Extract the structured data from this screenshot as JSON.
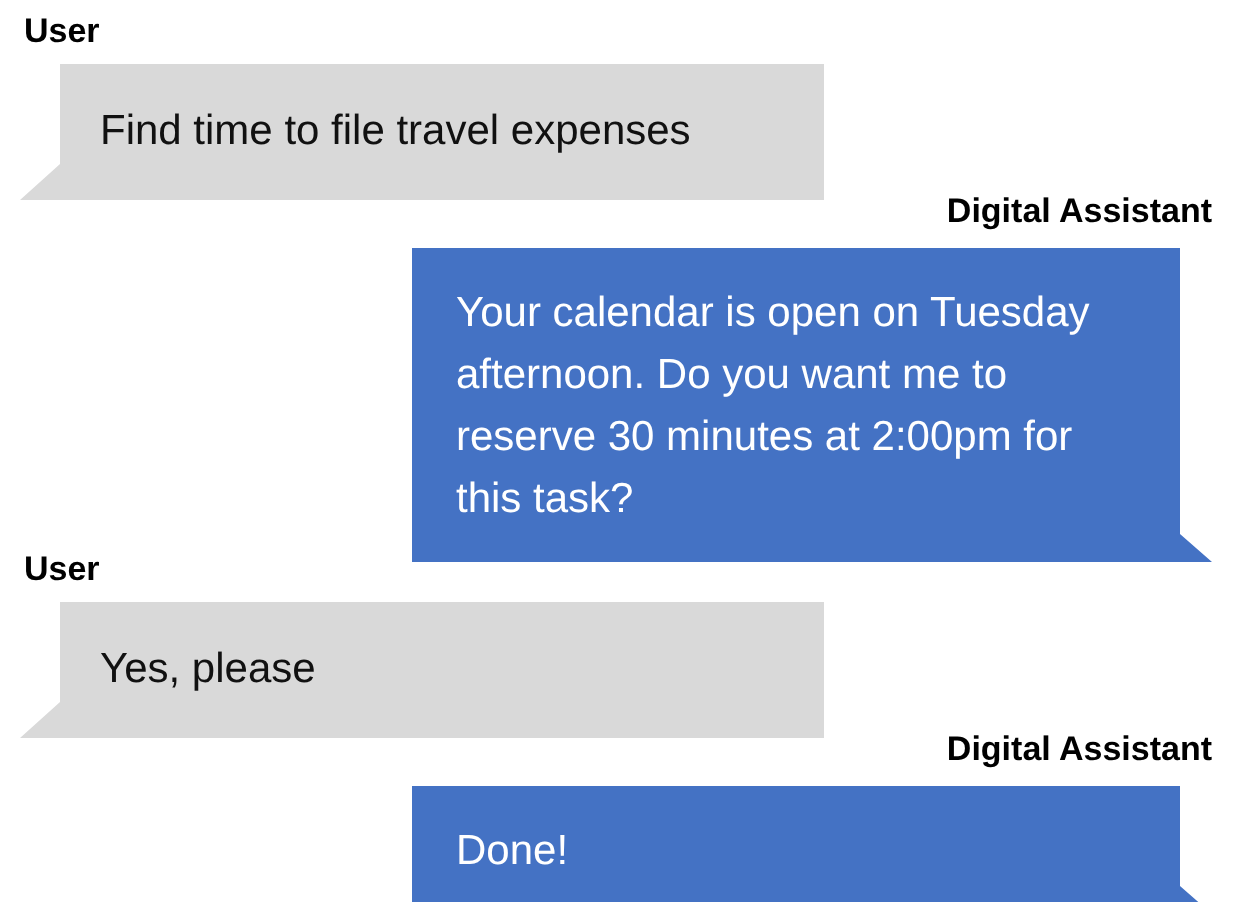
{
  "messages": [
    {
      "kind": "user",
      "sender": "User",
      "text": "Find time to file travel expenses"
    },
    {
      "kind": "assistant",
      "sender": "Digital Assistant",
      "text": "Your calendar is open on Tuesday afternoon. Do you want me to reserve 30 minutes at 2:00pm for this task?"
    },
    {
      "kind": "user",
      "sender": "User",
      "text": "Yes, please"
    },
    {
      "kind": "assistant",
      "sender": "Digital Assistant",
      "text": "Done!"
    }
  ]
}
